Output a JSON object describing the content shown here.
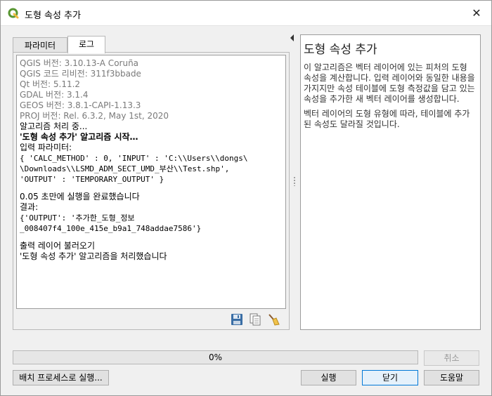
{
  "window": {
    "title": "도형 속성 추가",
    "close_glyph": "✕"
  },
  "tabs": [
    {
      "label": "파라미터",
      "active": false
    },
    {
      "label": "로그",
      "active": true
    }
  ],
  "log": {
    "lines": [
      {
        "text": "QGIS 버전: 3.10.13-A Coruña",
        "style": "dim"
      },
      {
        "text": "QGIS 코드 리비전: 311f3bbade",
        "style": "dim"
      },
      {
        "text": "Qt 버전: 5.11.2",
        "style": "dim"
      },
      {
        "text": "GDAL 버전: 3.1.4",
        "style": "dim"
      },
      {
        "text": "GEOS 버전: 3.8.1-CAPI-1.13.3",
        "style": "dim"
      },
      {
        "text": "PROJ 버전: Rel. 6.3.2, May 1st, 2020",
        "style": "dim"
      },
      {
        "text": "알고리즘 처리 중...",
        "style": "normal"
      },
      {
        "text": "'도형 속성 추가' 알고리즘 시작…",
        "style": "bold"
      },
      {
        "text": "입력 파라미터:",
        "style": "normal"
      },
      {
        "text": "{ 'CALC_METHOD' : 0, 'INPUT' : 'C:\\\\Users\\\\dongs\\",
        "style": "mono"
      },
      {
        "text": "\\Downloads\\\\LSMD_ADM_SECT_UMD_부산\\\\Test.shp',",
        "style": "mono"
      },
      {
        "text": "'OUTPUT' : 'TEMPORARY_OUTPUT' }",
        "style": "mono"
      },
      {
        "text": "",
        "style": "gap"
      },
      {
        "text": "0.05 초만에 실행을 완료했습니다",
        "style": "normal"
      },
      {
        "text": "결과:",
        "style": "normal"
      },
      {
        "text": "{'OUTPUT': '추가한_도형_정보",
        "style": "mono"
      },
      {
        "text": "_008407f4_100e_415e_b9a1_748addae7586'}",
        "style": "mono"
      },
      {
        "text": "",
        "style": "gap"
      },
      {
        "text": "출력 레이어 불러오기",
        "style": "normal"
      },
      {
        "text": "'도형 속성 추가' 알고리즘을 처리했습니다",
        "style": "normal"
      }
    ]
  },
  "help": {
    "title": "도형 속성 추가",
    "paragraph1": "이 알고리즘은 벡터 레이어에 있는 피처의 도형 속성을 계산합니다. 입력 레이어와 동일한 내용을 가지지만 속성 테이블에 도형 측정값을 담고 있는 속성을 추가한 새 벡터 레이어를 생성합니다.",
    "paragraph2": "벡터 레이어의 도형 유형에 따라, 테이블에 추가된 속성도 달라질 것입니다."
  },
  "progress": {
    "value": 0,
    "label": "0%"
  },
  "buttons": {
    "cancel": "취소",
    "batch": "배치 프로세스로 실행...",
    "run": "실행",
    "close": "닫기",
    "help": "도움말"
  },
  "colors": {
    "accent": "#0078d7",
    "qgis_green": "#589632",
    "qgis_yellow": "#f0b93e"
  }
}
